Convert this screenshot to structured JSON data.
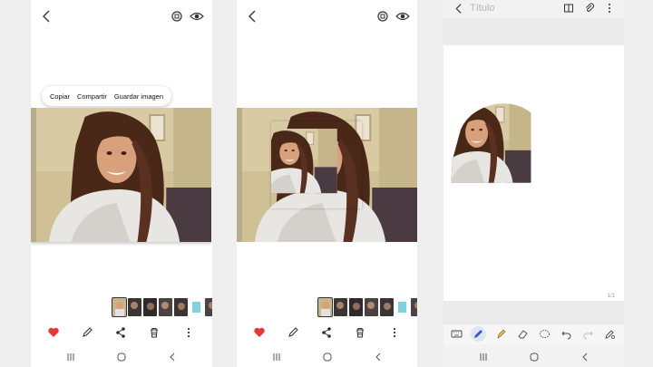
{
  "menu": {
    "copy": "Copiar",
    "share": "Compartir",
    "save_image": "Guardar imagen"
  },
  "notes": {
    "title_placeholder": "Título",
    "page_indicator": "1/1"
  },
  "icons": {
    "back": "chevron-left-icon",
    "rotate": "rotate-icon",
    "eye": "eye-icon",
    "favorite": "heart-icon",
    "edit": "pencil-icon",
    "share": "share-icon",
    "delete": "trash-icon",
    "more": "more-vertical-icon",
    "nav_recents": "recents-icon",
    "nav_home": "home-icon",
    "nav_back": "back-icon",
    "book": "book-icon",
    "attach": "paperclip-icon",
    "keyboard": "keyboard-icon",
    "pen": "pen-icon",
    "highlighter": "highlighter-icon",
    "eraser": "eraser-icon",
    "lasso": "lasso-icon",
    "undo": "undo-icon",
    "redo": "redo-icon",
    "pen_settings": "pen-settings-icon"
  },
  "colors": {
    "favorite": "#e53935",
    "pen_active": "#2e5bd8",
    "highlighter": "#f2c318"
  }
}
